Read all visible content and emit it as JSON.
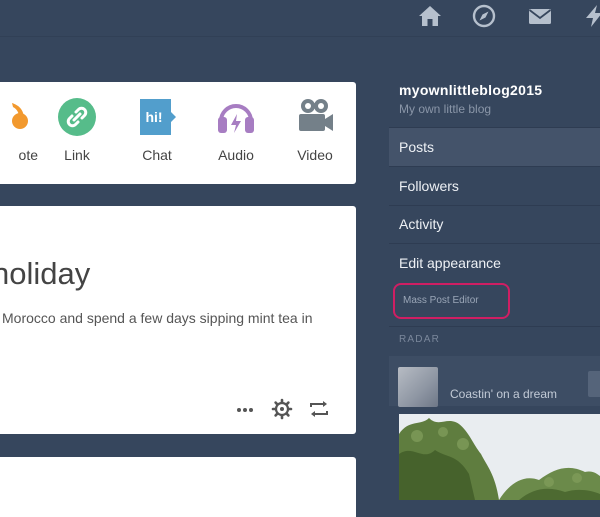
{
  "header": {
    "icons": [
      "home-icon",
      "explore-icon",
      "inbox-icon",
      "activity-icon"
    ]
  },
  "post_types": [
    {
      "label": "ote",
      "icon": "quote-icon",
      "color": "#f2992e"
    },
    {
      "label": "Link",
      "icon": "link-icon",
      "color": "#56bc8a"
    },
    {
      "label": "Chat",
      "icon": "chat-icon",
      "color": "#529ecc",
      "badge": "hi!"
    },
    {
      "label": "Audio",
      "icon": "audio-icon",
      "color": "#a77dc2"
    },
    {
      "label": "Video",
      "icon": "video-icon",
      "color": "#748089"
    }
  ],
  "post": {
    "title": "holiday",
    "body": "Morocco and spend a few days sipping mint tea in",
    "actions": [
      "more-icon",
      "settings-icon",
      "reblog-icon"
    ]
  },
  "sidebar": {
    "blog_name": "myownlittleblog2015",
    "blog_description": "My own little blog",
    "items": [
      {
        "label": "Posts",
        "active": true
      },
      {
        "label": "Followers",
        "active": false
      },
      {
        "label": "Activity",
        "active": false
      },
      {
        "label": "Edit appearance",
        "active": false
      }
    ],
    "mass_editor": "Mass Post Editor",
    "radar_header": "RADAR",
    "radar_blog": "Coastin' on a dream"
  },
  "colors": {
    "background": "#36465d",
    "highlight": "#cf1e63",
    "card": "#ffffff"
  }
}
